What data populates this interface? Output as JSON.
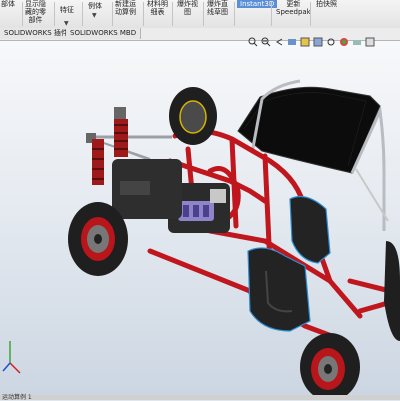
{
  "ribbon": {
    "items": [
      "部体",
      "显示隐\n藏的零\n部件",
      "特征",
      "例体",
      "新建运\n动算例",
      "材料明\n细表",
      "爆炸视\n图",
      "爆炸直\n线草图",
      "Instant3D",
      "更新\nSpeedpak",
      "拍快照"
    ]
  },
  "tabs": [
    "SOLIDWORKS 插件",
    "SOLIDWORKS MBD"
  ],
  "status": {
    "text": "运动算例 1"
  },
  "colors": {
    "frame": "#c0161d",
    "tire": "#1f1f1f",
    "roof": "#0c0c0c",
    "accent": "#2a8fd6"
  }
}
